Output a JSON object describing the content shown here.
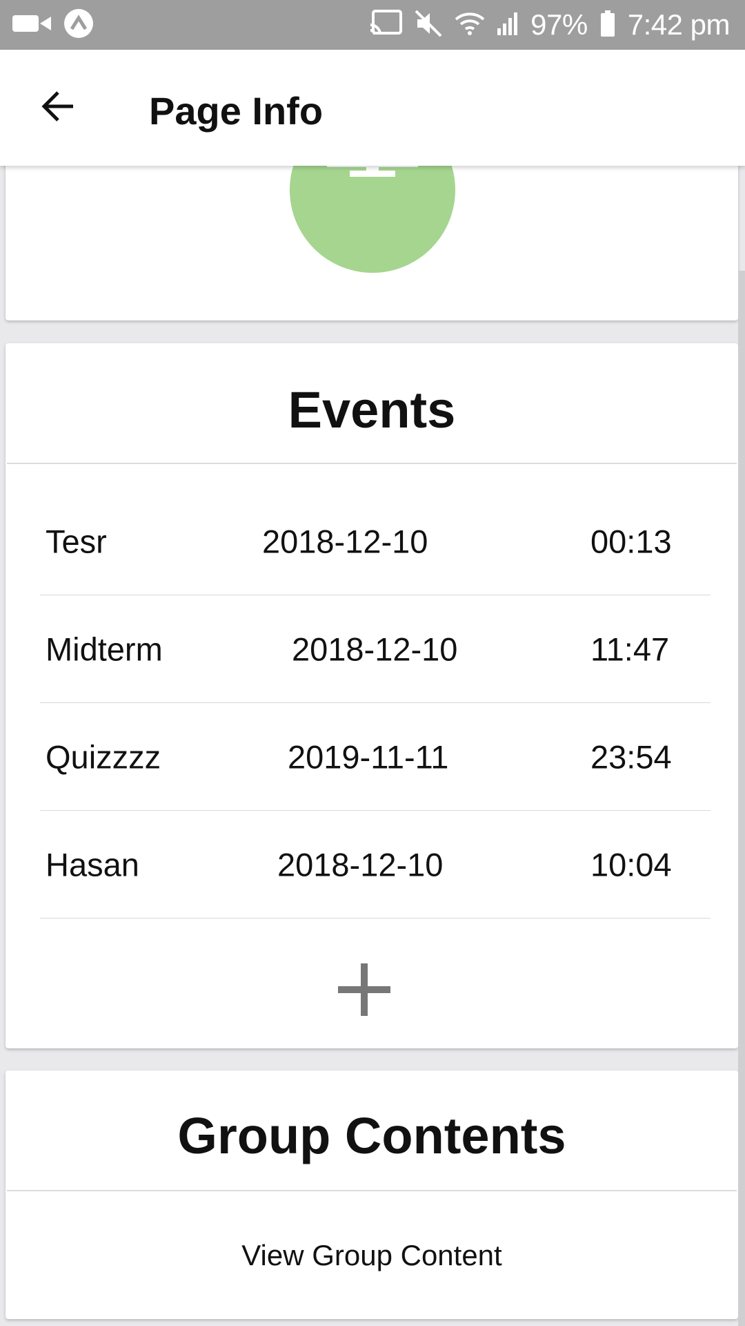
{
  "status_bar": {
    "battery": "97%",
    "time": "7:42 pm",
    "icons": [
      "video-camera-icon",
      "app-notification-icon",
      "cast-icon",
      "mute-icon",
      "wifi-icon",
      "signal-icon",
      "battery-icon"
    ]
  },
  "app_bar": {
    "title": "Page Info",
    "back_icon": "arrow-left-icon"
  },
  "profile": {
    "avatar_icon": "monitor-icon",
    "avatar_color": "#a5d58f"
  },
  "events": {
    "title": "Events",
    "rows": [
      {
        "name": "Tesr",
        "date": "2018-12-10",
        "time": "00:13"
      },
      {
        "name": "Midterm",
        "date": "2018-12-10",
        "time": "11:47"
      },
      {
        "name": "Quizzzz",
        "date": "2019-11-11",
        "time": "23:54"
      },
      {
        "name": "Hasan",
        "date": "2018-12-10",
        "time": "10:04"
      }
    ],
    "add_icon": "plus-icon"
  },
  "group_contents": {
    "title": "Group Contents",
    "link_label": "View Group Content"
  }
}
